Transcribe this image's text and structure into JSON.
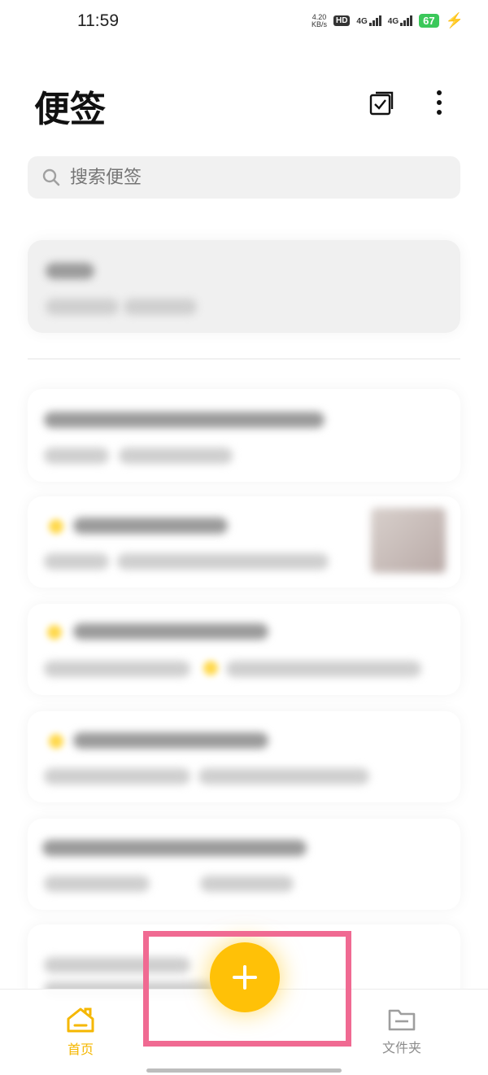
{
  "status_bar": {
    "time": "11:59",
    "speed_value": "4.20",
    "speed_unit": "KB/s",
    "hd_label": "HD",
    "net1": "4G",
    "net2": "4G",
    "battery": "67"
  },
  "header": {
    "title": "便签",
    "select_icon": "checkbox-select-icon",
    "more_icon": "more-vertical-icon"
  },
  "search": {
    "placeholder": "搜索便签",
    "icon": "search-icon"
  },
  "fab": {
    "icon": "plus-icon",
    "color": "#ffc107"
  },
  "bottom_nav": {
    "home_label": "首页",
    "home_color": "#f5b700",
    "folder_label": "文件夹",
    "folder_color": "#9e9e9e"
  },
  "highlight": {
    "color": "#f06a92"
  }
}
